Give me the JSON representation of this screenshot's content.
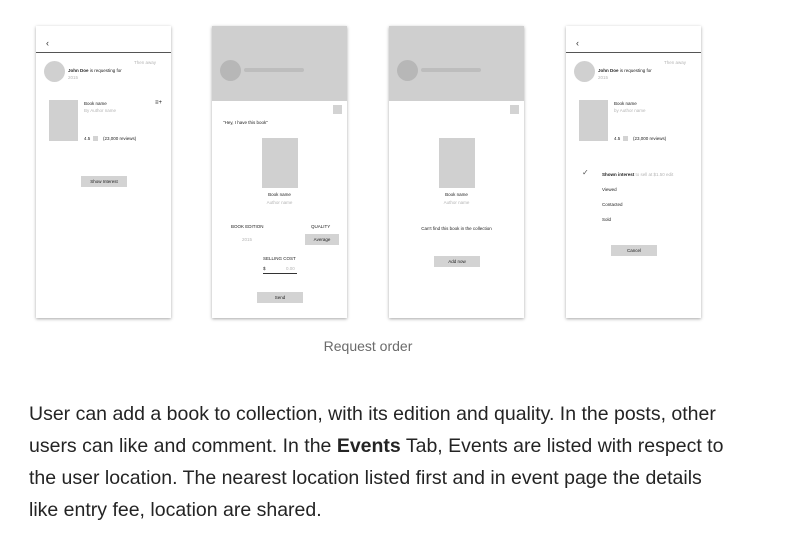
{
  "screens": {
    "request": {
      "back": "‹",
      "time": "Then away",
      "requester_name": "John Doe",
      "requester_text": " is requesting for",
      "requester_sub": "2015",
      "book_name": "Book name",
      "author": "By Author name",
      "rating": "4.5",
      "reviews": "(23,000 reviews)",
      "add_icon": "≡+",
      "show_interest": "Show Interest"
    },
    "have": {
      "quote": "\"Hey, I have this book\"",
      "book_name": "Book name",
      "author": "Author name",
      "edition_label": "BOOK EDITION",
      "edition_value": "2015",
      "quality_label": "QUALITY",
      "quality_value": "Average",
      "cost_label": "SELLING COST",
      "currency": "$",
      "cost_value": "0.00",
      "send": "Send"
    },
    "notfound": {
      "book_name": "Book name",
      "author": "Author name",
      "message": "Can't find this book in the collection",
      "add_now": "Add now"
    },
    "status": {
      "back": "‹",
      "time": "Then away",
      "requester_name": "John Doe",
      "requester_text": " is requesting for",
      "requester_sub": "2015",
      "book_name": "Book name",
      "author": "by Author name",
      "rating": "4.5",
      "reviews": "(23,000 reviews)",
      "check": "✓",
      "shown_interest": "Shown interest",
      "shown_interest_sub": " to sell at $1.50 edit",
      "viewed": "Viewed",
      "contacted": "Contacted",
      "sold": "Sold",
      "cancel": "Cancel"
    }
  },
  "caption": "Request order",
  "paragraph": {
    "part1": "User can add a book to collection, with its edition and quality. In the posts, other users can like and comment. In the ",
    "bold": "Events",
    "part2": " Tab, Events are listed with respect to the user location. The nearest location listed first and in event page the details like entry fee, location are shared."
  }
}
